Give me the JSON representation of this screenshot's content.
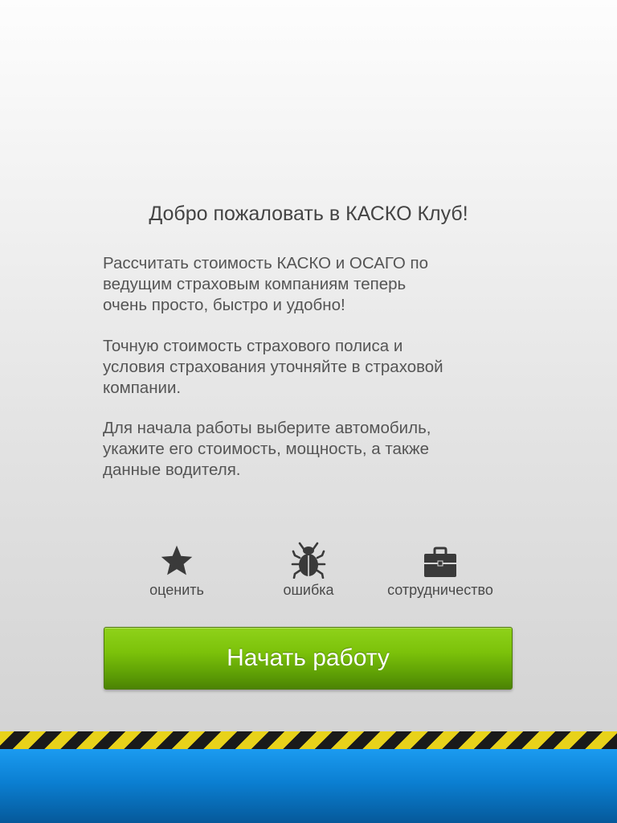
{
  "welcome": {
    "title": "Добро пожаловать в КАСКО Клуб!"
  },
  "paragraphs": [
    "Рассчитать стоимость КАСКО и ОСАГО по\nведущим страховым компаниям теперь\nочень просто, быстро и удобно!",
    "Точную стоимость страхового полиса и\nусловия страхования уточняйте в страховой\nкомпании.",
    "Для начала работы выберите автомобиль,\nукажите его стоимость, мощность, а также\nданные водителя."
  ],
  "actions": [
    {
      "label": "оценить",
      "icon": "star-icon"
    },
    {
      "label": "ошибка",
      "icon": "bug-icon"
    },
    {
      "label": "сотрудничество",
      "icon": "briefcase-icon"
    }
  ],
  "start_button": {
    "label": "Начать работу"
  },
  "colors": {
    "accent_green": "#7cc20a",
    "bottom_blue": "#0b7fd2",
    "hazard_yellow": "#e8d21a",
    "hazard_black": "#1a1a1a",
    "text": "#555555"
  }
}
